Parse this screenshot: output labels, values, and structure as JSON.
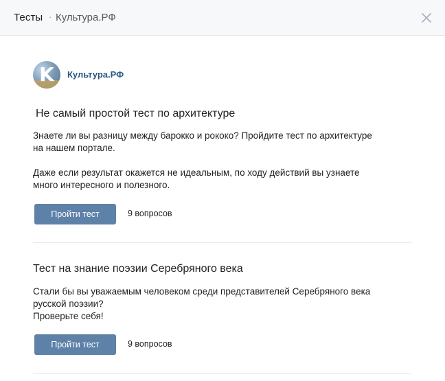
{
  "header": {
    "title": "Тесты",
    "separator": "·",
    "community": "Культура.РФ",
    "close_icon": "close-icon"
  },
  "community": {
    "avatar_letter": "K",
    "name": "Культура.РФ"
  },
  "tests": [
    {
      "title": "Не самый простой тест по архитектуре",
      "description_lines": [
        "Знаете ли вы разницу между барокко и рококо? Пройдите тест по архитектуре",
        "на нашем портале.",
        "",
        "Даже если результат окажется не идеальным, по ходу действий вы узнаете",
        "много интересного и полезного."
      ],
      "button_label": "Пройти тест",
      "question_count": "9 вопросов"
    },
    {
      "title": "Тест на знание поэзии Серебряного века",
      "description_lines": [
        "Стали бы вы уважаемым человеком среди представителей Серебряного века",
        "русской поэзии?",
        "Проверьте себя!"
      ],
      "button_label": "Пройти тест",
      "question_count": "9 вопросов"
    }
  ],
  "colors": {
    "accent_button": "#5e81a8",
    "link": "#2a5885",
    "header_bg": "#f7f8fa"
  }
}
